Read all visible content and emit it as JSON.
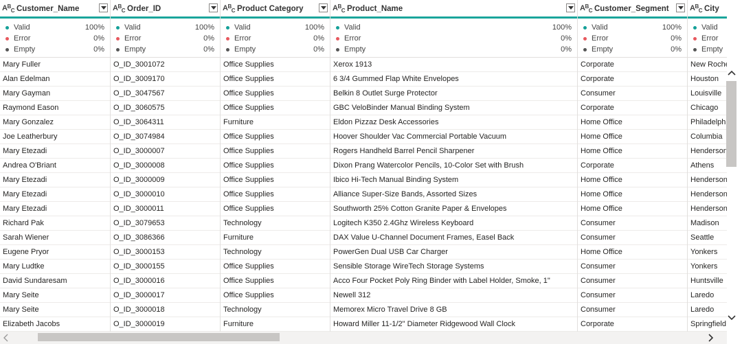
{
  "quality_labels": {
    "valid": "Valid",
    "error": "Error",
    "empty": "Empty"
  },
  "type_icon": {
    "main": "A",
    "sup": "B",
    "sub": "C"
  },
  "columns": [
    {
      "name": "Customer_Name",
      "valid": "100%",
      "error": "0%",
      "empty": "0%"
    },
    {
      "name": "Order_ID",
      "valid": "100%",
      "error": "0%",
      "empty": "0%"
    },
    {
      "name": "Product Category",
      "valid": "100%",
      "error": "0%",
      "empty": "0%"
    },
    {
      "name": "Product_Name",
      "valid": "100%",
      "error": "0%",
      "empty": "0%"
    },
    {
      "name": "Customer_Segment",
      "valid": "100%",
      "error": "0%",
      "empty": "0%"
    },
    {
      "name": "City",
      "valid": "",
      "error": "",
      "empty": ""
    }
  ],
  "rows": [
    [
      "Mary Fuller",
      "O_ID_3001072",
      "Office Supplies",
      "Xerox 1913",
      "Corporate",
      "New Rochelle"
    ],
    [
      "Alan Edelman",
      "O_ID_3009170",
      "Office Supplies",
      "6 3/4 Gummed Flap White Envelopes",
      "Corporate",
      "Houston"
    ],
    [
      "Mary Gayman",
      "O_ID_3047567",
      "Office Supplies",
      "Belkin 8 Outlet Surge Protector",
      "Consumer",
      "Louisville"
    ],
    [
      "Raymond Eason",
      "O_ID_3060575",
      "Office Supplies",
      "GBC VeloBinder Manual Binding System",
      "Corporate",
      "Chicago"
    ],
    [
      "Mary Gonzalez",
      "O_ID_3064311",
      "Furniture",
      "Eldon Pizzaz Desk Accessories",
      "Home Office",
      "Philadelphia"
    ],
    [
      "Joe Leatherbury",
      "O_ID_3074984",
      "Office Supplies",
      "Hoover Shoulder Vac Commercial Portable Vacuum",
      "Home Office",
      "Columbia"
    ],
    [
      "Mary Etezadi",
      "O_ID_3000007",
      "Office Supplies",
      "Rogers Handheld Barrel Pencil Sharpener",
      "Home Office",
      "Henderson"
    ],
    [
      "Andrea O'Briant",
      "O_ID_3000008",
      "Office Supplies",
      "Dixon Prang Watercolor Pencils, 10-Color Set with Brush",
      "Corporate",
      "Athens"
    ],
    [
      "Mary Etezadi",
      "O_ID_3000009",
      "Office Supplies",
      "Ibico Hi-Tech Manual Binding System",
      "Home Office",
      "Henderson"
    ],
    [
      "Mary Etezadi",
      "O_ID_3000010",
      "Office Supplies",
      "Alliance Super-Size Bands, Assorted Sizes",
      "Home Office",
      "Henderson"
    ],
    [
      "Mary Etezadi",
      "O_ID_3000011",
      "Office Supplies",
      "Southworth 25% Cotton Granite Paper & Envelopes",
      "Home Office",
      "Henderson"
    ],
    [
      "Richard Pak",
      "O_ID_3079653",
      "Technology",
      "Logitech K350 2.4Ghz Wireless Keyboard",
      "Consumer",
      "Madison"
    ],
    [
      "Sarah Wiener",
      "O_ID_3086366",
      "Furniture",
      "DAX Value U-Channel Document Frames, Easel Back",
      "Consumer",
      "Seattle"
    ],
    [
      "Eugene Pryor",
      "O_ID_3000153",
      "Technology",
      "PowerGen Dual USB Car Charger",
      "Home Office",
      "Yonkers"
    ],
    [
      "Mary Ludtke",
      "O_ID_3000155",
      "Office Supplies",
      "Sensible Storage WireTech Storage Systems",
      "Consumer",
      "Yonkers"
    ],
    [
      "David Sundaresam",
      "O_ID_3000016",
      "Office Supplies",
      "Acco Four Pocket Poly Ring Binder with Label Holder, Smoke, 1\"",
      "Consumer",
      "Huntsville"
    ],
    [
      "Mary Seite",
      "O_ID_3000017",
      "Office Supplies",
      "Newell 312",
      "Consumer",
      "Laredo"
    ],
    [
      "Mary Seite",
      "O_ID_3000018",
      "Technology",
      "Memorex Micro Travel Drive 8 GB",
      "Consumer",
      "Laredo"
    ],
    [
      "Elizabeth Jacobs",
      "O_ID_3000019",
      "Furniture",
      "Howard Miller 11-1/2\" Diameter Ridgewood Wall Clock",
      "Corporate",
      "Springfield"
    ]
  ],
  "colors": {
    "accent": "#1aa59b",
    "valid": "#14a098",
    "error": "#e8585e",
    "empty": "#555555"
  },
  "icons": {
    "scroll_up": "chevron-up-icon",
    "scroll_down": "chevron-down-icon",
    "scroll_right": "chevron-right-icon",
    "scroll_left": "chevron-left-icon",
    "dropdown": "chevron-down-icon",
    "type": "text-type-icon"
  }
}
